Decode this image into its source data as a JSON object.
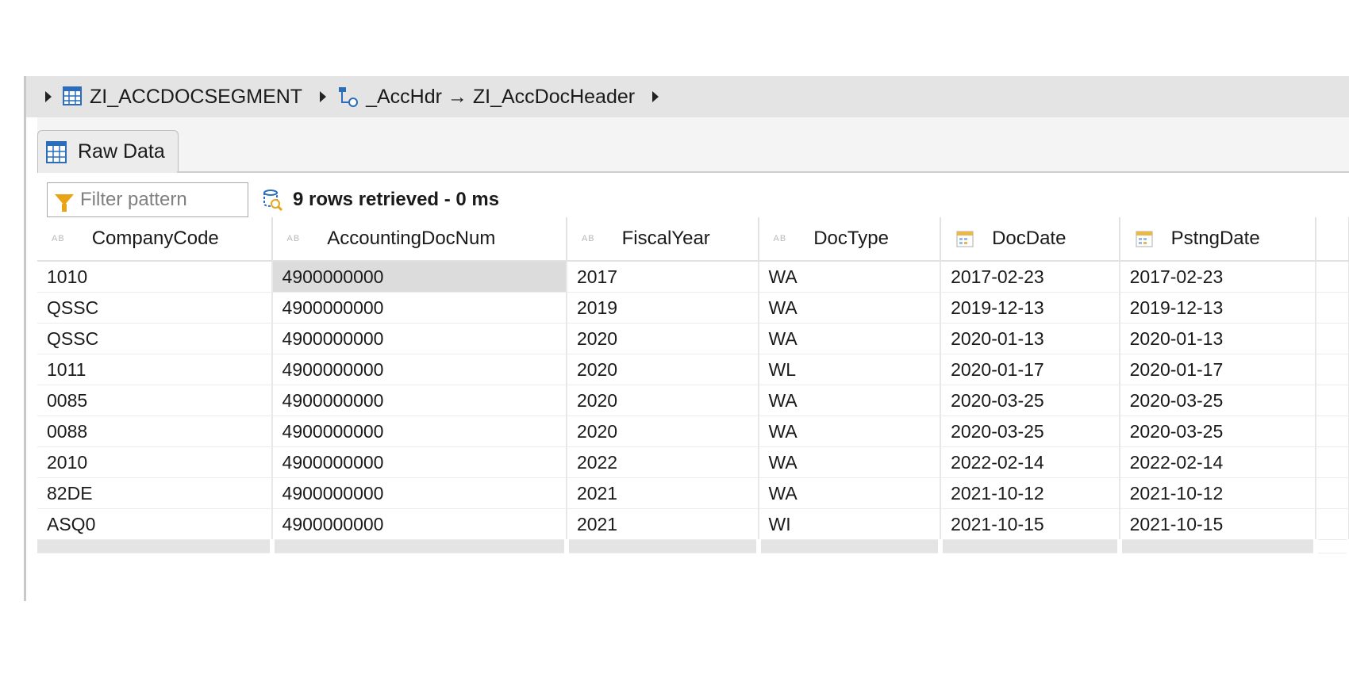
{
  "breadcrumb": {
    "entity": "ZI_ACCDOCSEGMENT",
    "association": "_AccHdr → ZI_AccDocHeader"
  },
  "tab": {
    "label": "Raw Data"
  },
  "toolbar": {
    "filter_placeholder": "Filter pattern",
    "status": "9 rows retrieved - 0 ms"
  },
  "colors": {
    "accent": "#2a6ebb",
    "filter": "#e8a317",
    "date_icon": "#e9b84a"
  },
  "table": {
    "columns": [
      {
        "label": "CompanyCode",
        "type_icon": "text-type-icon"
      },
      {
        "label": "AccountingDocNum",
        "type_icon": "text-type-icon"
      },
      {
        "label": "FiscalYear",
        "type_icon": "text-type-icon"
      },
      {
        "label": "DocType",
        "type_icon": "text-type-icon"
      },
      {
        "label": "DocDate",
        "type_icon": "date-type-icon"
      },
      {
        "label": "PstngDate",
        "type_icon": "date-type-icon"
      }
    ],
    "rows": [
      [
        "1010",
        "4900000000",
        "2017",
        "WA",
        "2017-02-23",
        "2017-02-23"
      ],
      [
        "QSSC",
        "4900000000",
        "2019",
        "WA",
        "2019-12-13",
        "2019-12-13"
      ],
      [
        "QSSC",
        "4900000000",
        "2020",
        "WA",
        "2020-01-13",
        "2020-01-13"
      ],
      [
        "1011",
        "4900000000",
        "2020",
        "WL",
        "2020-01-17",
        "2020-01-17"
      ],
      [
        "0085",
        "4900000000",
        "2020",
        "WA",
        "2020-03-25",
        "2020-03-25"
      ],
      [
        "0088",
        "4900000000",
        "2020",
        "WA",
        "2020-03-25",
        "2020-03-25"
      ],
      [
        "2010",
        "4900000000",
        "2022",
        "WA",
        "2022-02-14",
        "2022-02-14"
      ],
      [
        "82DE",
        "4900000000",
        "2021",
        "WA",
        "2021-10-12",
        "2021-10-12"
      ],
      [
        "ASQ0",
        "4900000000",
        "2021",
        "WI",
        "2021-10-15",
        "2021-10-15"
      ]
    ]
  }
}
